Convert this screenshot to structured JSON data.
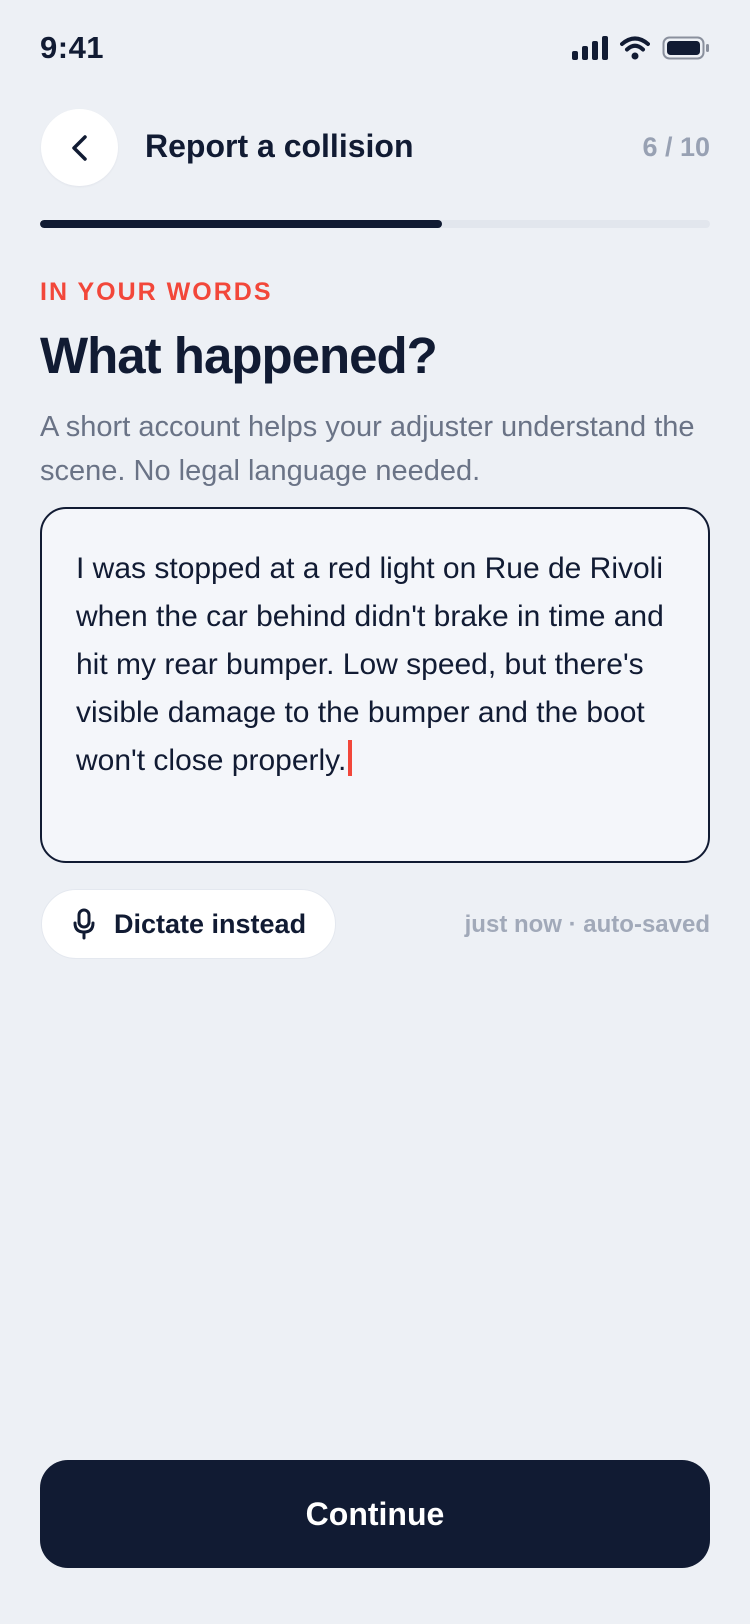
{
  "status_bar": {
    "time": "9:41",
    "icons": [
      "signal-icon",
      "wifi-icon",
      "battery-icon"
    ]
  },
  "header": {
    "back_icon": "chevron-left-icon",
    "title": "Report a collision",
    "step_counter": "6 / 10"
  },
  "progress": {
    "current_step": 6,
    "total_steps": 10,
    "fraction": 0.6
  },
  "question": {
    "eyebrow": "IN YOUR WORDS",
    "title": "What happened?",
    "subtitle": "A short account helps your adjuster understand the scene. No legal language needed."
  },
  "answer": {
    "value": "I was stopped at a red light on Rue de Rivoli when the car behind didn't brake in time and hit my rear bumper. Low speed, but there's visible damage to the bumper and the boot won't close properly."
  },
  "dictate": {
    "icon": "microphone-icon",
    "label": "Dictate instead"
  },
  "autosave": {
    "status": "just now · auto-saved"
  },
  "footer": {
    "continue_label": "Continue"
  },
  "colors": {
    "background": "#EDF0F5",
    "ink": "#111B33",
    "accent": "#F2473A",
    "muted": "#6A7386",
    "subtle": "#98A1B3"
  }
}
